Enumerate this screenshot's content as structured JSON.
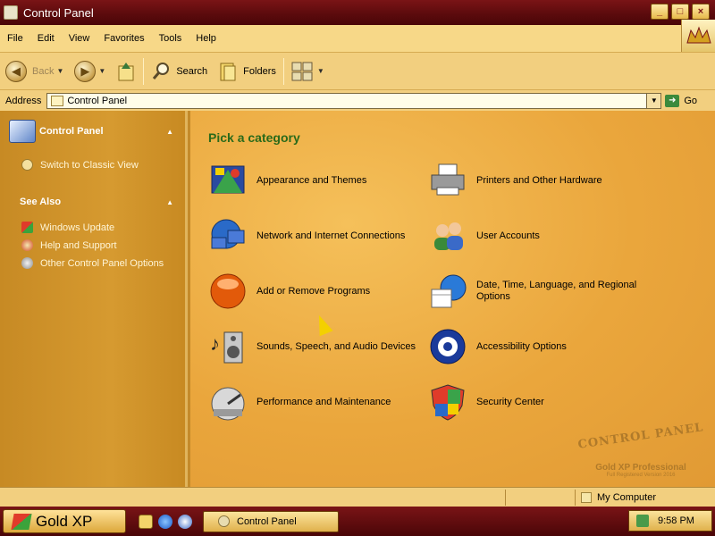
{
  "window": {
    "title": "Control Panel",
    "controls": {
      "minimize": "_",
      "maximize": "□",
      "close": "×"
    }
  },
  "menubar": {
    "items": [
      "File",
      "Edit",
      "View",
      "Favorites",
      "Tools",
      "Help"
    ]
  },
  "toolbar": {
    "back_label": "Back",
    "search_label": "Search",
    "folders_label": "Folders"
  },
  "address": {
    "label": "Address",
    "value": "Control Panel",
    "go_label": "Go"
  },
  "sidebar": {
    "panel1": {
      "title": "Control Panel",
      "links": [
        "Switch to Classic View"
      ]
    },
    "panel2": {
      "title": "See Also",
      "links": [
        "Windows Update",
        "Help and Support",
        "Other Control Panel Options"
      ]
    }
  },
  "main": {
    "heading": "Pick a category",
    "categories": [
      {
        "label": "Appearance and Themes",
        "icon": "appearance-themes-icon"
      },
      {
        "label": "Printers and Other Hardware",
        "icon": "printer-icon"
      },
      {
        "label": "Network and Internet Connections",
        "icon": "network-icon"
      },
      {
        "label": "User Accounts",
        "icon": "user-accounts-icon"
      },
      {
        "label": "Add or Remove Programs",
        "icon": "add-remove-programs-icon"
      },
      {
        "label": "Date, Time, Language, and Regional Options",
        "icon": "date-time-globe-icon"
      },
      {
        "label": "Sounds, Speech, and Audio Devices",
        "icon": "speaker-icon"
      },
      {
        "label": "Accessibility Options",
        "icon": "accessibility-icon"
      },
      {
        "label": "Performance and Maintenance",
        "icon": "performance-icon"
      },
      {
        "label": "Security Center",
        "icon": "security-shield-icon"
      }
    ],
    "watermark": {
      "line1": "CONTROL PANEL",
      "line2": "Gold XP Professional",
      "line3": "Full Registered Version 2016"
    }
  },
  "statusbar": {
    "location": "My Computer"
  },
  "taskbar": {
    "start_label": "Gold XP",
    "task_label": "Control Panel",
    "clock": "9:58 PM"
  },
  "colors": {
    "title_bar": "#5a0a0c",
    "menu_bg": "#f7d888",
    "sidebar_bg": "#d69a30",
    "main_bg": "#eaa63c",
    "heading": "#2a6a1a"
  }
}
